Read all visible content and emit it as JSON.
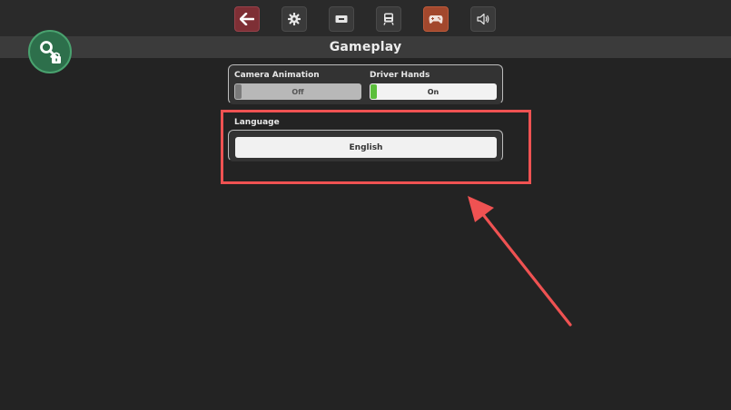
{
  "toolbar": {
    "buttons": [
      {
        "name": "back",
        "icon": "arrow-left-icon"
      },
      {
        "name": "settings",
        "icon": "gear-icon"
      },
      {
        "name": "display",
        "icon": "display-icon"
      },
      {
        "name": "vehicle",
        "icon": "train-icon"
      },
      {
        "name": "gameplay",
        "icon": "gamepad-icon",
        "active": true
      },
      {
        "name": "audio",
        "icon": "speaker-icon"
      }
    ],
    "accent_back": "#7e2f35",
    "accent_active": "#a2482d"
  },
  "header": {
    "title": "Gameplay"
  },
  "badge": {
    "icon": "key-lock-icon",
    "color": "#2d6f4b"
  },
  "options": {
    "camera_animation": {
      "label": "Camera Animation",
      "value": "Off",
      "enabled": false
    },
    "driver_hands": {
      "label": "Driver Hands",
      "value": "On",
      "enabled": true,
      "on_color": "#5bbe3b"
    },
    "language": {
      "label": "Language",
      "value": "English"
    }
  },
  "annotation": {
    "color": "#ef5252",
    "shapes": [
      "highlight-box",
      "arrow"
    ]
  }
}
